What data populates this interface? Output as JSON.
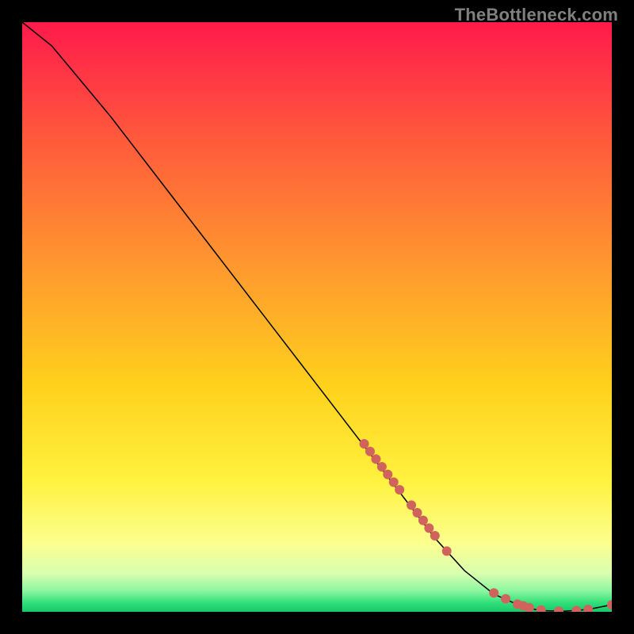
{
  "watermark": "TheBottleneck.com",
  "chart_data": {
    "type": "line",
    "title": "",
    "xlabel": "",
    "ylabel": "",
    "xlim": [
      0,
      100
    ],
    "ylim": [
      0,
      100
    ],
    "grid": false,
    "legend": false,
    "background_gradient_stops": [
      {
        "offset": 0.0,
        "color": "#ff1a4b"
      },
      {
        "offset": 0.2,
        "color": "#ff5a3c"
      },
      {
        "offset": 0.42,
        "color": "#ff9a2e"
      },
      {
        "offset": 0.62,
        "color": "#ffd21c"
      },
      {
        "offset": 0.78,
        "color": "#fff240"
      },
      {
        "offset": 0.885,
        "color": "#fcff8f"
      },
      {
        "offset": 0.935,
        "color": "#d8ffb0"
      },
      {
        "offset": 0.965,
        "color": "#8bf59e"
      },
      {
        "offset": 0.985,
        "color": "#2fe07a"
      },
      {
        "offset": 1.0,
        "color": "#18c768"
      }
    ],
    "series": [
      {
        "name": "bottleneck-curve",
        "x": [
          0,
          5,
          10,
          15,
          20,
          25,
          30,
          35,
          40,
          45,
          50,
          55,
          60,
          65,
          70,
          75,
          80,
          85,
          88,
          92,
          96,
          100
        ],
        "y": [
          100,
          96,
          90,
          84,
          77.5,
          71,
          64.5,
          58,
          51.5,
          45,
          38.5,
          32,
          25.5,
          19,
          12.5,
          7,
          3,
          0.8,
          0.2,
          0.1,
          0.4,
          1.2
        ]
      }
    ],
    "markers": {
      "name": "highlighted-points",
      "color": "#d0645c",
      "radius": 6,
      "x": [
        58,
        59,
        60,
        61,
        62,
        63,
        64,
        66,
        67,
        68,
        69,
        70,
        72,
        80,
        82,
        84,
        85,
        86,
        88,
        91,
        94,
        96,
        100
      ],
      "y": [
        28.5,
        27.2,
        25.9,
        24.6,
        23.3,
        22,
        20.7,
        18.1,
        16.8,
        15.5,
        14.2,
        12.9,
        10.3,
        3.2,
        2.2,
        1.3,
        1.0,
        0.7,
        0.3,
        0.1,
        0.2,
        0.4,
        1.2
      ]
    }
  }
}
